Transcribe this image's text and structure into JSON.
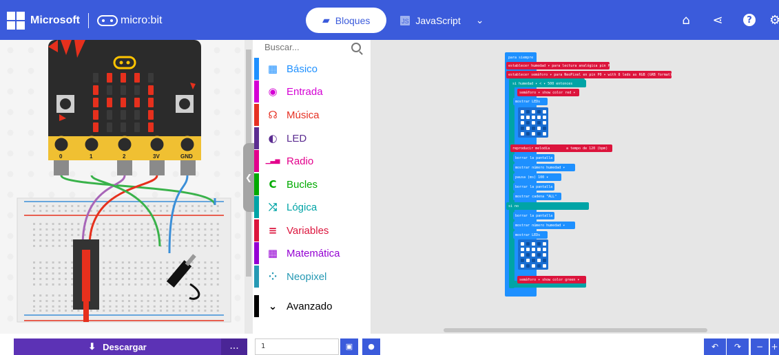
{
  "header": {
    "brand": "Microsoft",
    "product": "micro:bit",
    "tab_blocks": "Bloques",
    "tab_js": "JavaScript",
    "icons": [
      "home-icon",
      "share-icon",
      "help-icon",
      "settings-icon"
    ],
    "color": "#3b5bdb"
  },
  "toolbox": {
    "search_placeholder": "Buscar...",
    "categories": [
      {
        "label": "Básico",
        "color": "#1e90ff",
        "icon": "grid-icon"
      },
      {
        "label": "Entrada",
        "color": "#d400d4",
        "icon": "target-icon"
      },
      {
        "label": "Música",
        "color": "#e63022",
        "icon": "headphones-icon"
      },
      {
        "label": "LED",
        "color": "#5c2d91",
        "icon": "toggle-icon"
      },
      {
        "label": "Radio",
        "color": "#e3008c",
        "icon": "signal-icon"
      },
      {
        "label": "Bucles",
        "color": "#00aa00",
        "icon": "loop-icon"
      },
      {
        "label": "Lógica",
        "color": "#00a4a6",
        "icon": "shuffle-icon"
      },
      {
        "label": "Variables",
        "color": "#dc143c",
        "icon": "list-icon"
      },
      {
        "label": "Matemática",
        "color": "#9400d3",
        "icon": "calculator-icon"
      },
      {
        "label": "Neopixel",
        "color": "#2699b4",
        "icon": "dots-circle-icon"
      },
      {
        "label": "Avanzado",
        "color": "#000000",
        "icon": "chevron-down-icon"
      }
    ]
  },
  "sim": {
    "pins": [
      "0",
      "1",
      "2",
      "3V",
      "GND"
    ],
    "button_a": "A",
    "button_b": "B"
  },
  "workspace": {
    "blocks": [
      "para siempre",
      "establecer humedad ▾ para lectura analógica pin P0 ▾",
      "establecer semáforo ▾ para NeoPixel en pin P0 ▾ with 8 leds as RGB (GRB format) ▾",
      "si humedad ▾ < ▾ 500 entonces",
      "semáforo ▾ show color red ▾",
      "mostrar LEDs",
      "reproducir melodía",
      "a tempo de 120 (bpm)",
      "borrar la pantalla",
      "mostrar número humedad ▾",
      "pausa (ms) 100 ▾",
      "borrar la pantalla",
      "mostrar cadena \"ALL\"",
      "si no",
      "borrar la pantalla",
      "mostrar número humedad ▾",
      "mostrar LEDs",
      "semáforo ▾ show color green ▾"
    ]
  },
  "bottom": {
    "download_label": "Descargar",
    "more_label": "...",
    "project_name": "1"
  }
}
